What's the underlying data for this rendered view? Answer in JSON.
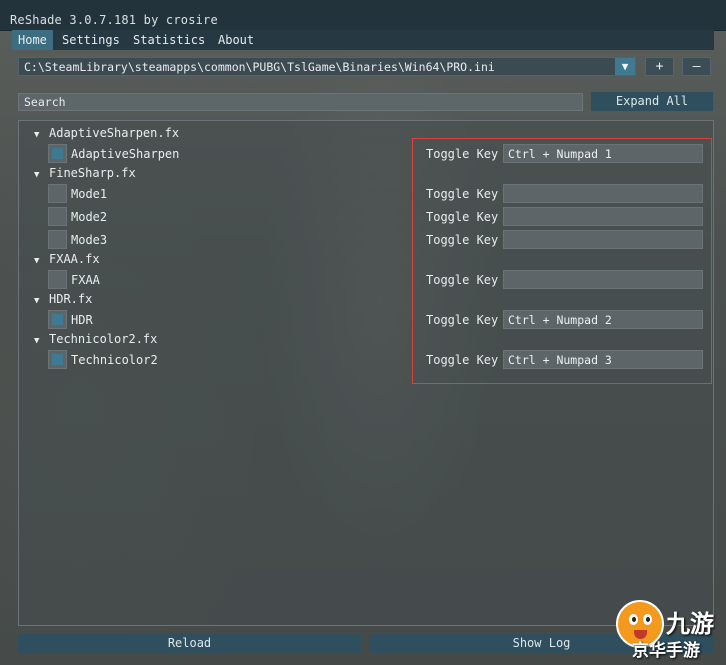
{
  "window": {
    "title": "ReShade 3.0.7.181 by crosire"
  },
  "menu": [
    {
      "label": "Home",
      "active": true
    },
    {
      "label": "Settings",
      "active": false
    },
    {
      "label": "Statistics",
      "active": false
    },
    {
      "label": "About",
      "active": false
    }
  ],
  "preset": {
    "path": "C:\\SteamLibrary\\steamapps\\common\\PUBG\\TslGame\\Binaries\\Win64\\PRO.ini",
    "add_label": "+",
    "remove_label": "–",
    "dropdown_icon": "triangle-down-icon"
  },
  "search": {
    "placeholder": "Search"
  },
  "expand_label": "Expand All",
  "toggle_label": "Toggle Key",
  "effects": [
    {
      "file": "AdaptiveSharpen.fx",
      "techniques": [
        {
          "name": "AdaptiveSharpen",
          "enabled": true,
          "key": "Ctrl + Numpad 1"
        }
      ]
    },
    {
      "file": "FineSharp.fx",
      "techniques": [
        {
          "name": "Mode1",
          "enabled": false,
          "key": ""
        },
        {
          "name": "Mode2",
          "enabled": false,
          "key": ""
        },
        {
          "name": "Mode3",
          "enabled": false,
          "key": ""
        }
      ]
    },
    {
      "file": "FXAA.fx",
      "techniques": [
        {
          "name": "FXAA",
          "enabled": false,
          "key": ""
        }
      ]
    },
    {
      "file": "HDR.fx",
      "techniques": [
        {
          "name": "HDR",
          "enabled": true,
          "key": "Ctrl + Numpad 2"
        }
      ]
    },
    {
      "file": "Technicolor2.fx",
      "techniques": [
        {
          "name": "Technicolor2",
          "enabled": true,
          "key": "Ctrl + Numpad 3"
        }
      ]
    }
  ],
  "bottom": {
    "reload_label": "Reload",
    "showlog_label": "Show Log"
  },
  "watermark": {
    "text": "九游",
    "subtext": "京华手游"
  },
  "colors": {
    "accent": "#3f7a92",
    "highlight_border": "#d9413c",
    "titlebar": "#23333c"
  }
}
